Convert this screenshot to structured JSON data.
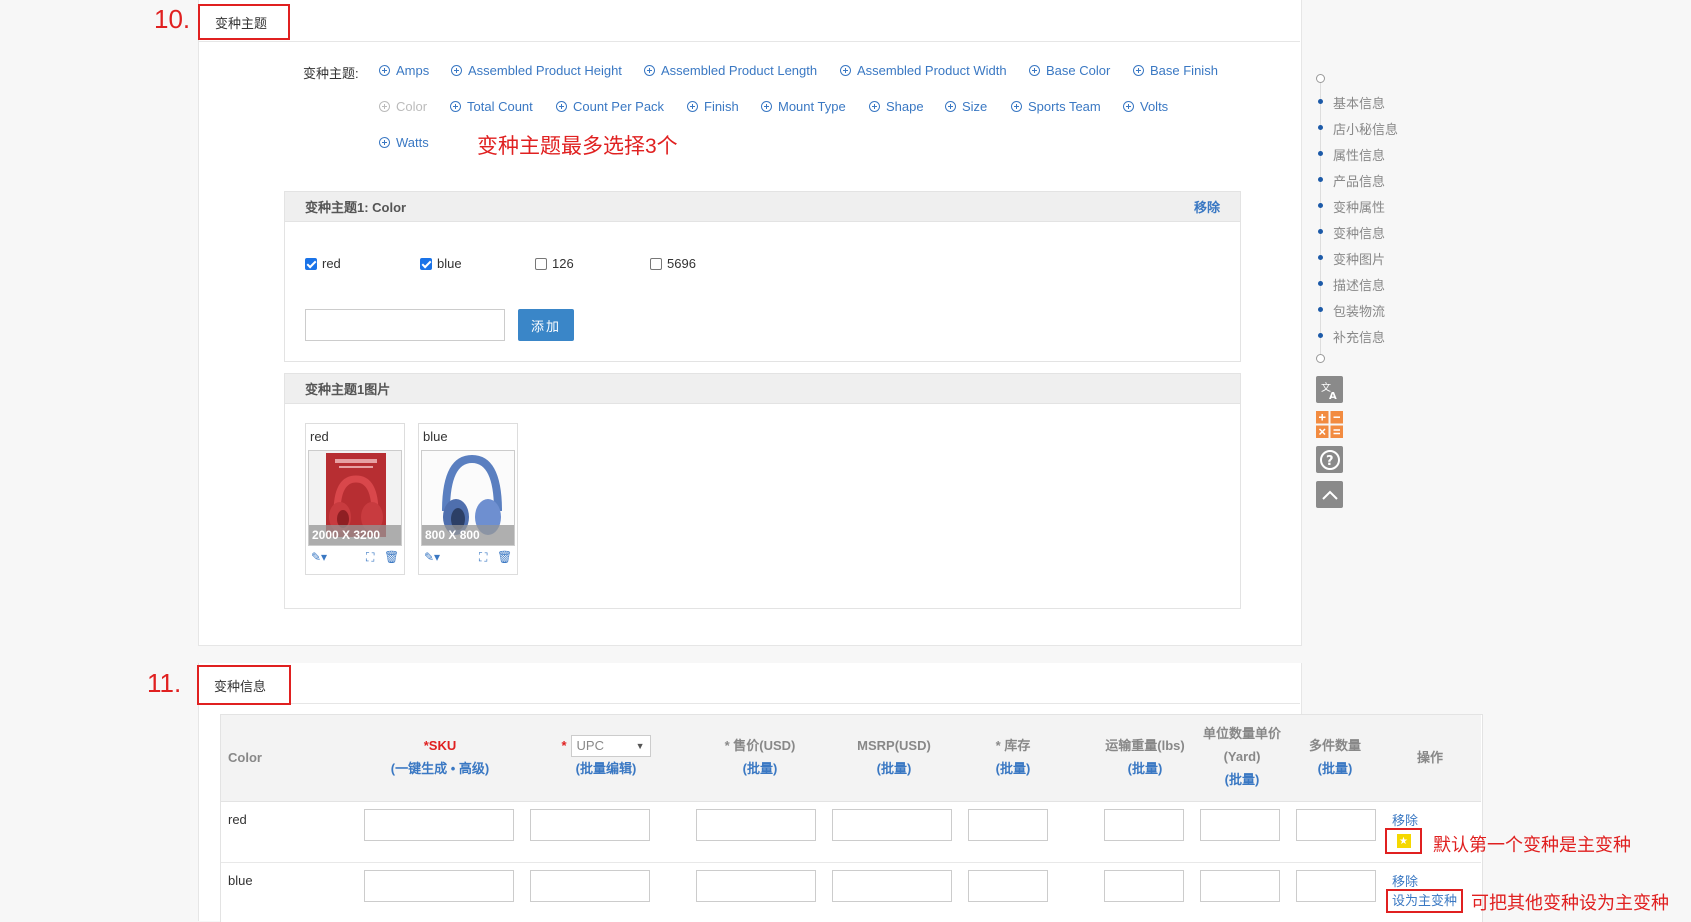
{
  "section10": {
    "number": "10.",
    "title": "变种主题",
    "theme_label": "变种主题:",
    "options": [
      {
        "label": "Amps",
        "enabled": true
      },
      {
        "label": "Assembled Product Height",
        "enabled": true
      },
      {
        "label": "Assembled Product Length",
        "enabled": true
      },
      {
        "label": "Assembled Product Width",
        "enabled": true
      },
      {
        "label": "Base Color",
        "enabled": true
      },
      {
        "label": "Base Finish",
        "enabled": true
      },
      {
        "label": "Color",
        "enabled": false
      },
      {
        "label": "Total Count",
        "enabled": true
      },
      {
        "label": "Count Per Pack",
        "enabled": true
      },
      {
        "label": "Finish",
        "enabled": true
      },
      {
        "label": "Mount Type",
        "enabled": true
      },
      {
        "label": "Shape",
        "enabled": true
      },
      {
        "label": "Size",
        "enabled": true
      },
      {
        "label": "Sports Team",
        "enabled": true
      },
      {
        "label": "Volts",
        "enabled": true
      },
      {
        "label": "Watts",
        "enabled": true
      }
    ],
    "max_note": "变种主题最多选择3个",
    "theme1": {
      "header": "变种主题1: Color",
      "remove": "移除",
      "values": [
        {
          "label": "red",
          "checked": true
        },
        {
          "label": "blue",
          "checked": true
        },
        {
          "label": "126",
          "checked": false
        },
        {
          "label": "5696",
          "checked": false
        }
      ],
      "add_value": "",
      "add_button": "添加"
    },
    "images": {
      "header": "变种主题1图片",
      "cards": [
        {
          "label": "red",
          "size": "2000 X 3200"
        },
        {
          "label": "blue",
          "size": "800 X 800"
        }
      ]
    }
  },
  "sidebar": {
    "items": [
      "基本信息",
      "店小秘信息",
      "属性信息",
      "产品信息",
      "变种属性",
      "变种信息",
      "变种图片",
      "描述信息",
      "包装物流",
      "补充信息"
    ],
    "tools": [
      "translate-icon",
      "calculator-icon",
      "help-icon",
      "back-to-top-icon"
    ]
  },
  "section11": {
    "number": "11.",
    "title": "变种信息",
    "headers": {
      "color": "Color",
      "sku": "*SKU",
      "sku_links": "(一键生成 • 高级)",
      "upc_select": "UPC",
      "upc_link": "(批量编辑)",
      "price": "* 售价(USD)",
      "msrp": "MSRP(USD)",
      "stock": "* 库存",
      "weight": "运输重量(lbs)",
      "unit_price_l1": "单位数量单价",
      "unit_price_l2": "(Yard)",
      "multi_qty": "多件数量",
      "ops": "操作",
      "batch": "(批量)"
    },
    "rows": [
      {
        "color": "red",
        "remove": "移除",
        "main_flag": "main-variant-star-icon"
      },
      {
        "color": "blue",
        "remove": "移除",
        "set_main": "设为主变种"
      }
    ],
    "annotation_main": "默认第一个变种是主变种",
    "annotation_set": "可把其他变种设为主变种"
  }
}
